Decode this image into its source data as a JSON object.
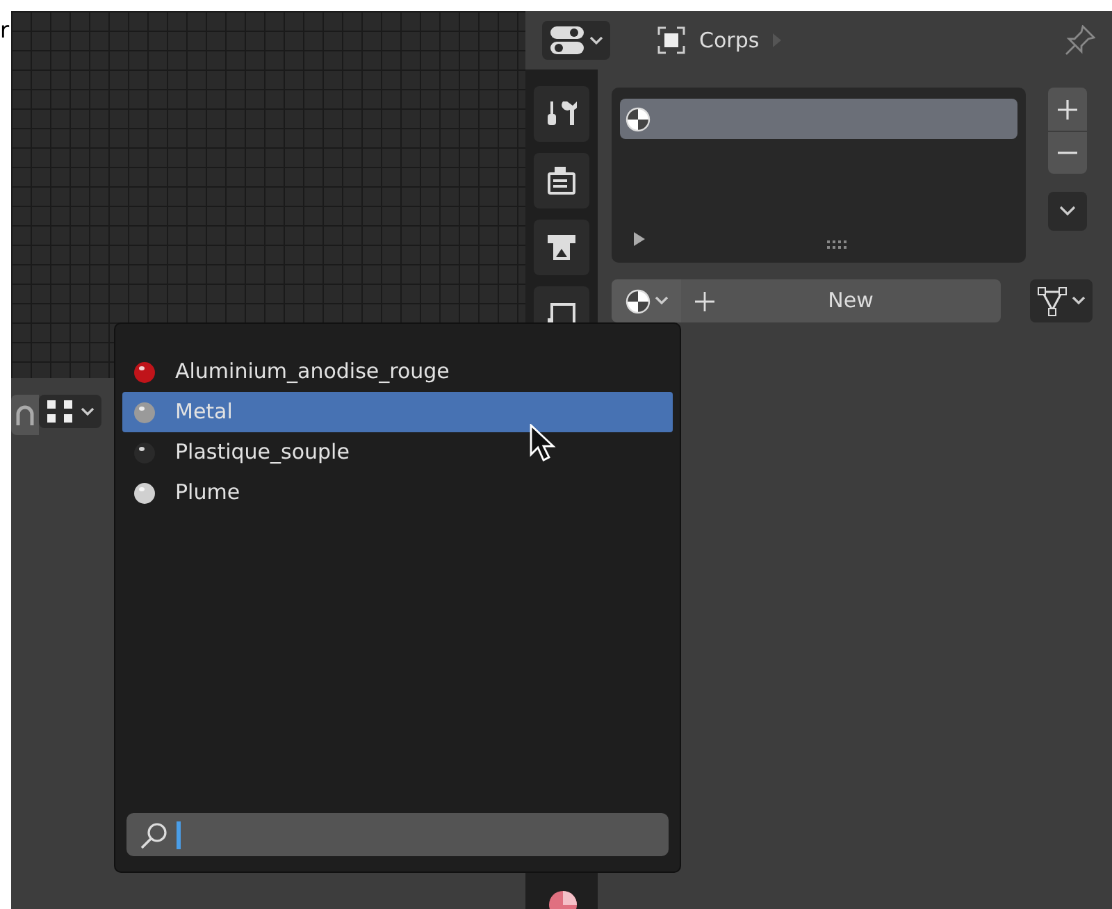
{
  "edge_fragment": "r",
  "properties": {
    "object_name": "Corps",
    "material_slots": [
      {
        "selected": true
      }
    ],
    "new_button": "New"
  },
  "material_menu": {
    "items": [
      {
        "name": "Aluminium_anodise_rouge",
        "color": "#c0141a",
        "selected": false
      },
      {
        "name": "Metal",
        "color": "#9a9a9a",
        "selected": true
      },
      {
        "name": "Plastique_souple",
        "color": "#2a2a2a",
        "selected": false
      },
      {
        "name": "Plume",
        "color": "#d0d0d0",
        "selected": false
      }
    ]
  }
}
